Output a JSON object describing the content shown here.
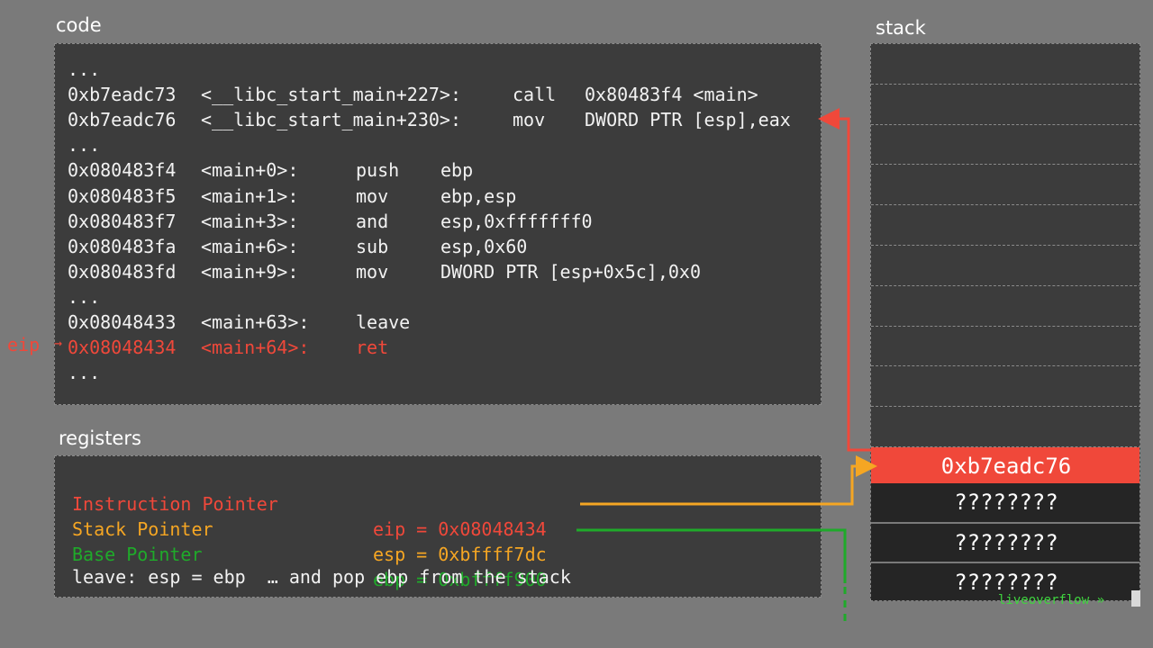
{
  "code": {
    "title": "code",
    "eip_label": "eip",
    "eip_arrow": "→",
    "lines": [
      {
        "addr": "...",
        "sym": "",
        "op": "",
        "args": ""
      },
      {
        "addr": "0xb7eadc73",
        "sym": "<__libc_start_main+227>:",
        "op": "call",
        "args": "0x80483f4 <main>"
      },
      {
        "addr": "0xb7eadc76",
        "sym": "<__libc_start_main+230>:",
        "op": "mov",
        "args": "DWORD PTR [esp],eax"
      },
      {
        "addr": "...",
        "sym": "",
        "op": "",
        "args": ""
      },
      {
        "addr": "0x080483f4",
        "sym": "<main+0>:",
        "op": "push",
        "args": "ebp"
      },
      {
        "addr": "0x080483f5",
        "sym": "<main+1>:",
        "op": "mov",
        "args": "ebp,esp"
      },
      {
        "addr": "0x080483f7",
        "sym": "<main+3>:",
        "op": "and",
        "args": "esp,0xfffffff0"
      },
      {
        "addr": "0x080483fa",
        "sym": "<main+6>:",
        "op": "sub",
        "args": "esp,0x60"
      },
      {
        "addr": "0x080483fd",
        "sym": "<main+9>:",
        "op": "mov",
        "args": "DWORD PTR [esp+0x5c],0x0"
      },
      {
        "addr": "...",
        "sym": "",
        "op": "",
        "args": ""
      },
      {
        "addr": "0x08048433",
        "sym": "<main+63>:",
        "op": "leave",
        "args": ""
      },
      {
        "addr": "0x08048434",
        "sym": "<main+64>:",
        "op": "ret",
        "args": ""
      },
      {
        "addr": "...",
        "sym": "",
        "op": "",
        "args": ""
      }
    ]
  },
  "registers": {
    "title": "registers",
    "rows": [
      {
        "name": "Instruction Pointer",
        "value": "eip = 0x08048434",
        "color": "#f0483a"
      },
      {
        "name": "Stack Pointer",
        "value": "esp = 0xbffff7dc",
        "color": "#f5a623"
      },
      {
        "name": "Base Pointer",
        "value": "ebp = 0xbffff900",
        "color": "#1faa2a"
      }
    ],
    "note": "leave: esp = ebp  … and pop ebp from the stack"
  },
  "stack": {
    "title": "stack",
    "return_address": "0xb7eadc76",
    "unknown_cells": [
      "????????",
      "????????",
      "????????"
    ]
  },
  "watermark": "liveoverflow »",
  "colors": {
    "eip": "#f0483a",
    "esp": "#f5a623",
    "ebp": "#1faa2a",
    "panel": "#3c3c3c",
    "background": "#7a7a7a"
  }
}
